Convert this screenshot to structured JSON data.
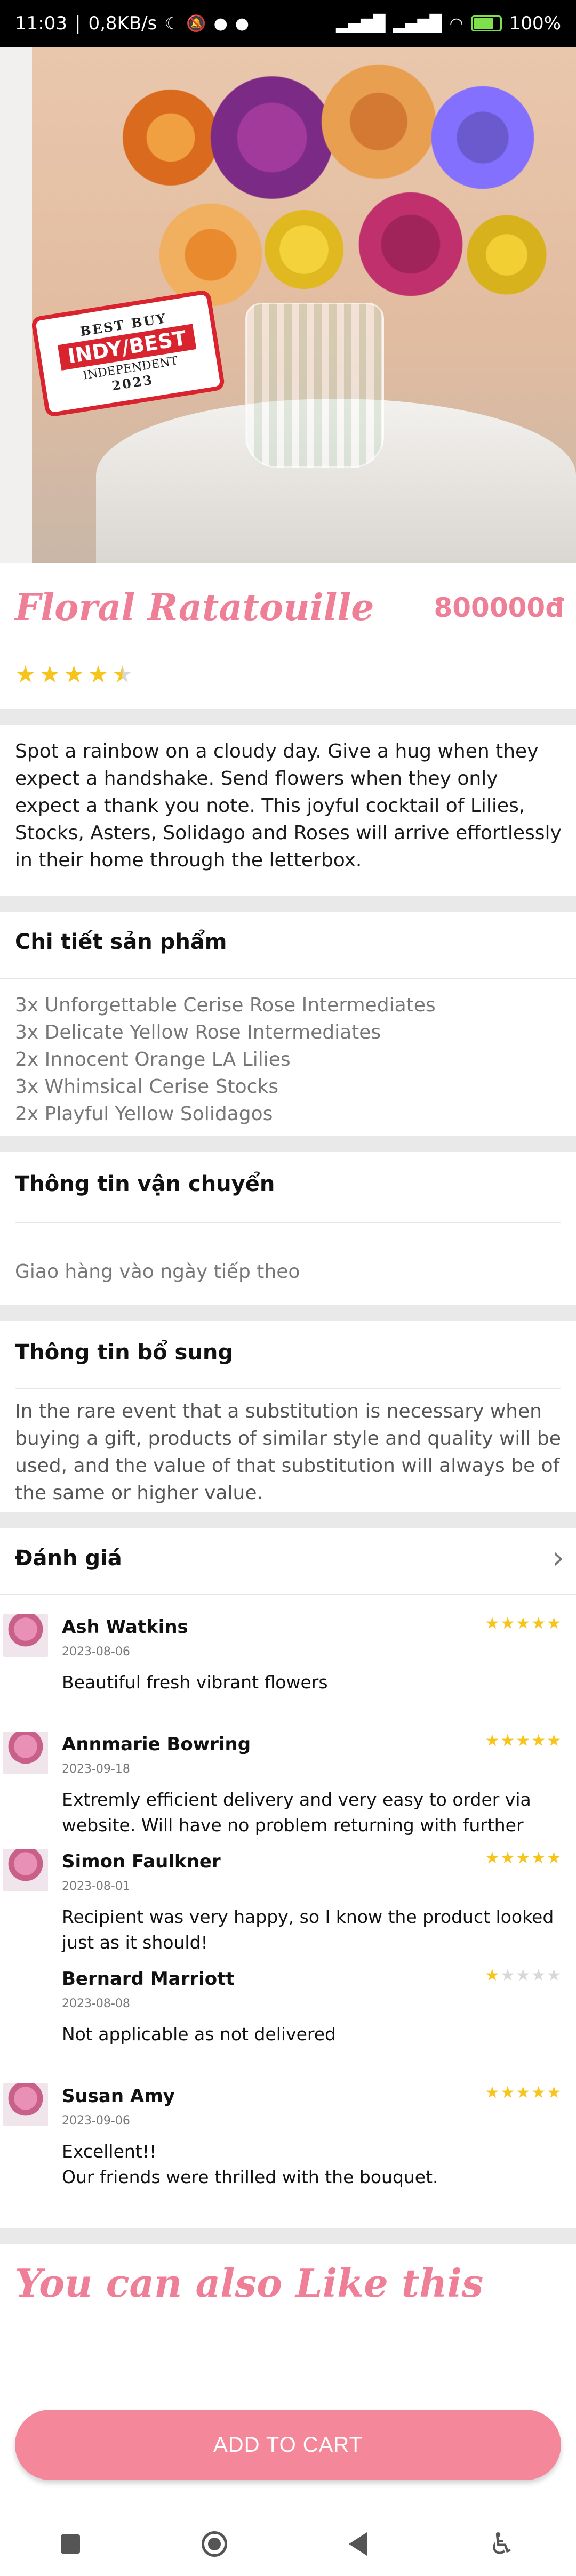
{
  "status_bar": {
    "time": "11:03",
    "speed": "0,8KB/s",
    "battery": "100%"
  },
  "product": {
    "title": "Floral Ratatouille",
    "price": "800000đ",
    "rating": 4.5,
    "badge": {
      "top": "BEST BUY",
      "main": "INDY/BEST",
      "sub": "INDEPENDENT",
      "year": "2023"
    },
    "description": "Spot a rainbow on a cloudy day. Give a hug when they expect a handshake. Send flowers when they only expect a thank you note. This joyful cocktail of Lilies, Stocks, Asters, Solidago and Roses will arrive effortlessly in their home through the letterbox."
  },
  "details": {
    "title": "Chi tiết sản phẩm",
    "items": [
      "3x Unforgettable Cerise Rose Intermediates",
      "3x Delicate Yellow Rose Intermediates",
      "2x Innocent Orange LA Lilies",
      "3x Whimsical Cerise Stocks",
      "2x Playful Yellow Solidagos"
    ]
  },
  "shipping": {
    "title": "Thông tin vận chuyển",
    "text": "Giao hàng vào ngày tiếp theo"
  },
  "additional": {
    "title": "Thông tin bổ sung",
    "text": " In the rare event that a substitution is necessary when buying a gift, products of similar style and quality will be used, and the value of that substitution will always be of the same or higher value."
  },
  "reviews": {
    "title": "Đánh giá",
    "items": [
      {
        "name": "Ash Watkins",
        "date": "2023-08-06",
        "text": "Beautiful fresh vibrant flowers",
        "stars": 5
      },
      {
        "name": "Annmarie Bowring",
        "date": "2023-09-18",
        "text": "Extremly efficient delivery and very easy to order via website. Will have no problem returning with further",
        "stars": 5
      },
      {
        "name": "Simon Faulkner",
        "date": "2023-08-01",
        "text": "Recipient was very happy, so I know the product looked just as it should!",
        "stars": 5
      },
      {
        "name": "Bernard  Marriott",
        "date": "2023-08-08",
        "text": "Not applicable as not delivered",
        "stars": 1
      },
      {
        "name": "Susan Amy",
        "date": "2023-09-06",
        "text": "Excellent!!\nOur friends were thrilled with the bouquet.",
        "stars": 5
      }
    ]
  },
  "also_like": "You can also Like this",
  "cart_button": "ADD TO CART",
  "colors": {
    "accent": "#ef7f97",
    "button": "#f5879a",
    "star": "#f7c41c",
    "divider": "#e9e9e9"
  },
  "icons": [
    "wifi-icon",
    "signal-icon",
    "battery-icon",
    "chevron-right-icon",
    "star-icon",
    "nav-recents-icon",
    "nav-home-icon",
    "nav-back-icon",
    "accessibility-icon"
  ]
}
